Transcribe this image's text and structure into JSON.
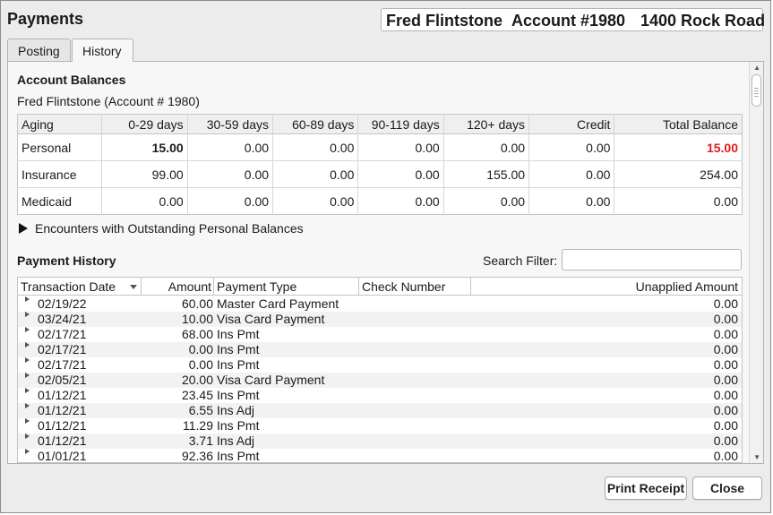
{
  "window": {
    "title": "Payments",
    "patient_name": "Fred Flintstone",
    "account": "Account #1980",
    "address": "1400 Rock Road"
  },
  "tabs": [
    {
      "label": "Posting",
      "active": false
    },
    {
      "label": "History",
      "active": true
    }
  ],
  "balances": {
    "heading": "Account Balances",
    "subtitle": "Fred Flintstone (Account # 1980)",
    "columns": [
      "Aging",
      "0-29 days",
      "30-59 days",
      "60-89 days",
      "90-119 days",
      "120+ days",
      "Credit",
      "Total Balance"
    ],
    "rows": [
      [
        "Personal",
        "15.00",
        "0.00",
        "0.00",
        "0.00",
        "0.00",
        "0.00",
        "15.00"
      ],
      [
        "Insurance",
        "99.00",
        "0.00",
        "0.00",
        "0.00",
        "155.00",
        "0.00",
        "254.00"
      ],
      [
        "Medicaid",
        "0.00",
        "0.00",
        "0.00",
        "0.00",
        "0.00",
        "0.00",
        "0.00"
      ]
    ],
    "highlight_color": "#e01b1b"
  },
  "encounters": {
    "label": "Encounters with Outstanding Personal Balances"
  },
  "history": {
    "heading": "Payment History",
    "search_label": "Search Filter:",
    "search_value": "",
    "columns": [
      "Transaction Date",
      "Amount",
      "Payment Type",
      "Check Number",
      "Unapplied Amount"
    ],
    "rows": [
      {
        "date": "02/19/22",
        "amount": "60.00",
        "type": "Master Card Payment",
        "check": "",
        "unapplied": "0.00"
      },
      {
        "date": "03/24/21",
        "amount": "10.00",
        "type": "Visa Card Payment",
        "check": "",
        "unapplied": "0.00"
      },
      {
        "date": "02/17/21",
        "amount": "68.00",
        "type": "Ins Pmt",
        "check": "",
        "unapplied": "0.00"
      },
      {
        "date": "02/17/21",
        "amount": "0.00",
        "type": "Ins Pmt",
        "check": "",
        "unapplied": "0.00"
      },
      {
        "date": "02/17/21",
        "amount": "0.00",
        "type": "Ins Pmt",
        "check": "",
        "unapplied": "0.00"
      },
      {
        "date": "02/05/21",
        "amount": "20.00",
        "type": "Visa Card Payment",
        "check": "",
        "unapplied": "0.00"
      },
      {
        "date": "01/12/21",
        "amount": "23.45",
        "type": "Ins Pmt",
        "check": "",
        "unapplied": "0.00"
      },
      {
        "date": "01/12/21",
        "amount": "6.55",
        "type": "Ins Adj",
        "check": "",
        "unapplied": "0.00"
      },
      {
        "date": "01/12/21",
        "amount": "11.29",
        "type": "Ins Pmt",
        "check": "",
        "unapplied": "0.00"
      },
      {
        "date": "01/12/21",
        "amount": "3.71",
        "type": "Ins Adj",
        "check": "",
        "unapplied": "0.00"
      },
      {
        "date": "01/01/21",
        "amount": "92.36",
        "type": "Ins Pmt",
        "check": "",
        "unapplied": "0.00"
      }
    ]
  },
  "buttons": {
    "print": "Print Receipt",
    "close": "Close"
  }
}
